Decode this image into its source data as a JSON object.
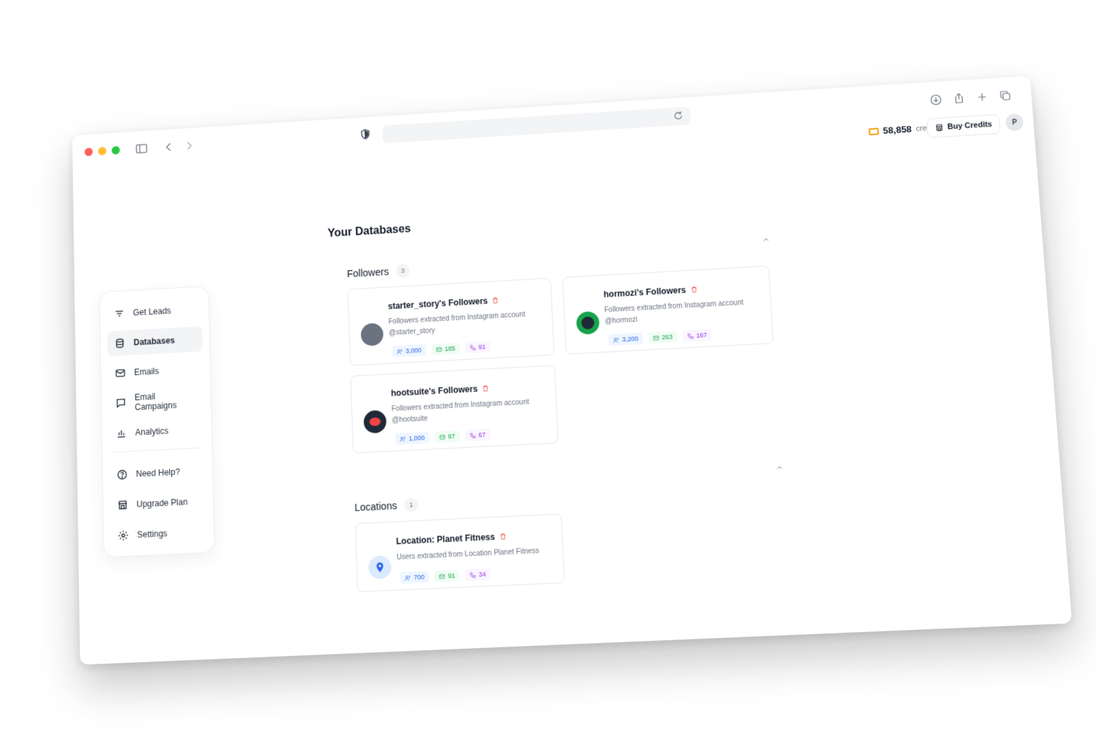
{
  "browser": {
    "url": ""
  },
  "header": {
    "credits_value": "58,858",
    "credits_label": "credits",
    "buy_label": "Buy Credits",
    "avatar_initial": "P"
  },
  "sidebar": {
    "items": [
      {
        "label": "Get Leads",
        "icon": "filter-icon"
      },
      {
        "label": "Databases",
        "icon": "database-icon",
        "active": true
      },
      {
        "label": "Emails",
        "icon": "mail-icon"
      },
      {
        "label": "Email Campaigns",
        "icon": "chat-icon"
      },
      {
        "label": "Analytics",
        "icon": "bar-chart-icon"
      }
    ],
    "secondary": [
      {
        "label": "Need Help?",
        "icon": "help-icon"
      },
      {
        "label": "Upgrade Plan",
        "icon": "store-icon"
      },
      {
        "label": "Settings",
        "icon": "gear-icon"
      }
    ]
  },
  "main": {
    "title": "Your Databases",
    "followers": {
      "heading": "Followers",
      "count": "3",
      "cards": [
        {
          "title": "starter_story's Followers",
          "desc": "Followers extracted from Instagram account",
          "handle": "@starter_story",
          "users": "3,000",
          "emails": "185",
          "phones": "91",
          "avatar_color": "#6b7280"
        },
        {
          "title": "hormozi's Followers",
          "desc": "Followers extracted from Instagram account",
          "handle": "@hormozi",
          "users": "3,200",
          "emails": "263",
          "phones": "167",
          "avatar_color": "#16a34a"
        },
        {
          "title": "hootsuite's Followers",
          "desc": "Followers extracted from Instagram account",
          "handle": "@hootsuite",
          "users": "1,000",
          "emails": "97",
          "phones": "67",
          "avatar_color": "#1f2937"
        }
      ]
    },
    "locations": {
      "heading": "Locations",
      "count": "1",
      "cards": [
        {
          "title": "Location: Planet Fitness",
          "desc": "Users extracted from Location Planet Fitness",
          "users": "700",
          "emails": "91",
          "phones": "34"
        }
      ]
    }
  }
}
